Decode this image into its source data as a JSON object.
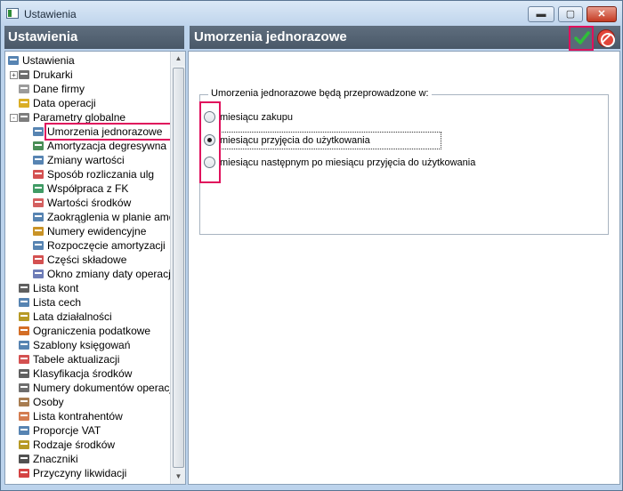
{
  "window": {
    "title": "Ustawienia"
  },
  "left_header": "Ustawienia",
  "right_header": "Umorzenia jednorazowe",
  "tree": [
    {
      "label": "Ustawienia",
      "level": 0,
      "icon": "tools-icon",
      "color": "#3a6ea5"
    },
    {
      "label": "Drukarki",
      "level": 1,
      "icon": "printer-icon",
      "color": "#555555",
      "expander": "+"
    },
    {
      "label": "Dane firmy",
      "level": 1,
      "icon": "document-icon",
      "color": "#8a8a8a"
    },
    {
      "label": "Data operacji",
      "level": 1,
      "icon": "calendar-icon",
      "color": "#d4a000"
    },
    {
      "label": "Parametry globalne",
      "level": 1,
      "icon": "parameters-icon",
      "color": "#666666",
      "expander": "-"
    },
    {
      "label": "Umorzenia jednorazowe",
      "level": 2,
      "icon": "calculator-icon",
      "color": "#3a6ea5",
      "selected": true
    },
    {
      "label": "Amortyzacja degresywna",
      "level": 2,
      "icon": "people-icon",
      "color": "#2a7a3a"
    },
    {
      "label": "Zmiany wartości",
      "level": 2,
      "icon": "chart-change-icon",
      "color": "#3a6ea5"
    },
    {
      "label": "Sposób rozliczania ulg",
      "level": 2,
      "icon": "calendar-grid-icon",
      "color": "#cc3333"
    },
    {
      "label": "Współpraca z FK",
      "level": 2,
      "icon": "fk-icon",
      "color": "#1e8a4a"
    },
    {
      "label": "Wartości środków",
      "level": 2,
      "icon": "money-icon",
      "color": "#cc4444"
    },
    {
      "label": "Zaokrąglenia w planie amor",
      "level": 2,
      "icon": "rounding-icon",
      "color": "#3a6ea5"
    },
    {
      "label": "Numery ewidencyjne",
      "level": 2,
      "icon": "numbering-icon",
      "color": "#c08000"
    },
    {
      "label": "Rozpoczęcie amortyzacji",
      "level": 2,
      "icon": "bar-chart-icon",
      "color": "#3a6ea5"
    },
    {
      "label": "Części składowe",
      "level": 2,
      "icon": "parts-icon",
      "color": "#cc3333"
    },
    {
      "label": "Okno zmiany daty operacji",
      "level": 2,
      "icon": "date-change-icon",
      "color": "#5566aa"
    },
    {
      "label": "Lista kont",
      "level": 1,
      "icon": "list-icon",
      "color": "#444444"
    },
    {
      "label": "Lista cech",
      "level": 1,
      "icon": "tag-icon",
      "color": "#3a6ea5"
    },
    {
      "label": "Lata działalności",
      "level": 1,
      "icon": "years-icon",
      "color": "#aa8800"
    },
    {
      "label": "Ograniczenia podatkowe",
      "level": 1,
      "icon": "tax-icon",
      "color": "#cc5500"
    },
    {
      "label": "Szablony księgowań",
      "level": 1,
      "icon": "template-icon",
      "color": "#3a6ea5"
    },
    {
      "label": "Tabele aktualizacji",
      "level": 1,
      "icon": "update-table-icon",
      "color": "#cc3333"
    },
    {
      "label": "Klasyfikacja środków",
      "level": 1,
      "icon": "classification-icon",
      "color": "#444444"
    },
    {
      "label": "Numery dokumentów operacji",
      "level": 1,
      "icon": "doc-number-icon",
      "color": "#555555"
    },
    {
      "label": "Osoby",
      "level": 1,
      "icon": "person-icon",
      "color": "#996633"
    },
    {
      "label": "Lista kontrahentów",
      "level": 1,
      "icon": "contractors-icon",
      "color": "#cc6633"
    },
    {
      "label": "Proporcje VAT",
      "level": 1,
      "icon": "vat-icon",
      "color": "#3a6ea5"
    },
    {
      "label": "Rodzaje środków",
      "level": 1,
      "icon": "asset-types-icon",
      "color": "#aa8800"
    },
    {
      "label": "Znaczniki",
      "level": 1,
      "icon": "flag-icon",
      "color": "#333333"
    },
    {
      "label": "Przyczyny likwidacji",
      "level": 1,
      "icon": "liquidation-icon",
      "color": "#cc2222"
    }
  ],
  "group": {
    "legend": "Umorzenia jednorazowe będą przeprowadzone w:",
    "options": [
      {
        "label": "miesiącu zakupu",
        "checked": false
      },
      {
        "label": "miesiącu przyjęcia do użytkowania",
        "checked": true
      },
      {
        "label": "miesiącu następnym po miesiącu przyjęcia do użytkowania",
        "checked": false
      }
    ]
  },
  "colors": {
    "header_bg": "#495868",
    "highlight": "#e0105c",
    "frame": "#bcd3ec"
  }
}
